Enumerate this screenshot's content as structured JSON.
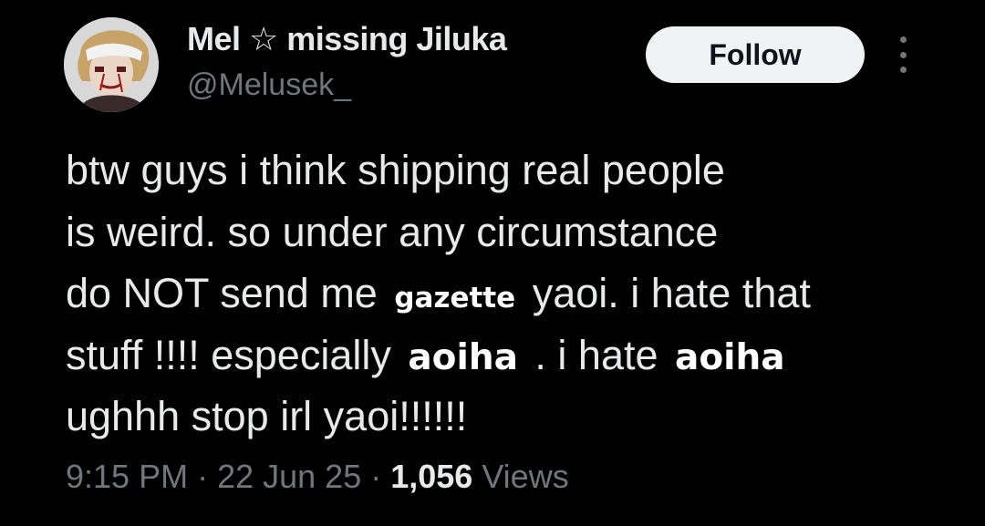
{
  "author": {
    "display_name": "Mel ☆ missing Jiluka",
    "handle": "@Melusek_"
  },
  "actions": {
    "follow_label": "Follow"
  },
  "tweet": {
    "line1": "btw guys i think shipping real people",
    "line2": "is weird. so under any circumstance",
    "line3_before": "do NOT send me ",
    "line3_overlay": "gazette",
    "line3_after": " yaoi. i hate that",
    "line4_before": "stuff !!!! especially ",
    "line4_overlay1": "aoiha",
    "line4_middle": " . i hate ",
    "line4_overlay2": "aoiha",
    "line5": "ughhh stop irl yaoi!!!!!!"
  },
  "meta": {
    "time": "9:15 PM",
    "separator": " · ",
    "date": "22 Jun 25",
    "views_count": "1,056",
    "views_label": " Views"
  },
  "colors": {
    "background": "#000000",
    "primary_text": "#e7e9ea",
    "secondary_text": "#71767b",
    "follow_button_bg": "#eff3f4"
  }
}
